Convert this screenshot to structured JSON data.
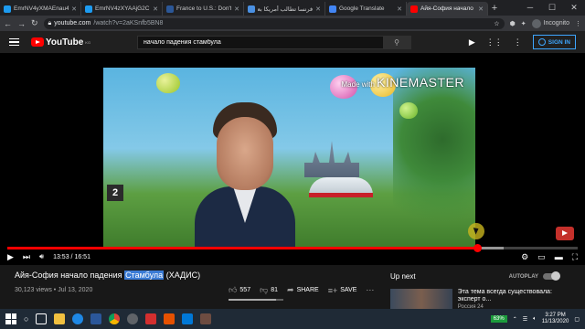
{
  "browser": {
    "tabs": [
      {
        "title": "EmrNV4yXMAEnau4 (680",
        "color": "#1d9bf0",
        "active": false
      },
      {
        "title": "EmrNV4zXYAAjG2C (680",
        "color": "#1d9bf0",
        "active": false
      },
      {
        "title": "France to U.S.: Don't W",
        "color": "#2b5797",
        "active": false
      },
      {
        "title": "فرنسا تطالب أمريكا بعد",
        "color": "#4a90e2",
        "active": false
      },
      {
        "title": "Google Translate",
        "color": "#4285f4",
        "active": false
      },
      {
        "title": "Айя-София начало па",
        "color": "#ff0000",
        "active": true
      }
    ],
    "new_tab": "+",
    "url_host": "youtube.com",
    "url_path": "/watch?v=2aKSnfb5BN8",
    "incognito_label": "Incognito"
  },
  "youtube": {
    "logo_text": "YouTube",
    "logo_region": "KG",
    "search_value": "начало падения стамбула",
    "signin_label": "SIGN IN"
  },
  "player": {
    "watermark_prefix": "Made with",
    "watermark_brand": "KINEMASTER",
    "sign_number": "2",
    "time_current": "13:53",
    "time_total": "16:51",
    "progress_fraction": 0.824,
    "buffer_fraction": 0.87
  },
  "video": {
    "title_before": "Айя-София начало падения ",
    "title_highlight": "Стамбула",
    "title_after": " (ХАДИС)",
    "views": "30,123 views",
    "date": "Jul 13, 2020",
    "likes": "557",
    "dislikes": "81",
    "share_label": "SHARE",
    "save_label": "SAVE",
    "like_ratio": 0.873
  },
  "sidebar": {
    "up_next_label": "Up next",
    "autoplay_label": "AUTOPLAY",
    "rec_title": "Эта тема всегда существовала: эксперт о...",
    "rec_channel": "Россия 24"
  },
  "taskbar": {
    "battery": "63%",
    "time": "3:27 PM",
    "date": "11/13/2020"
  },
  "colors": {
    "accent_red": "#ff0000",
    "link_blue": "#3ea6ff",
    "highlight": "#3a7bd5"
  }
}
